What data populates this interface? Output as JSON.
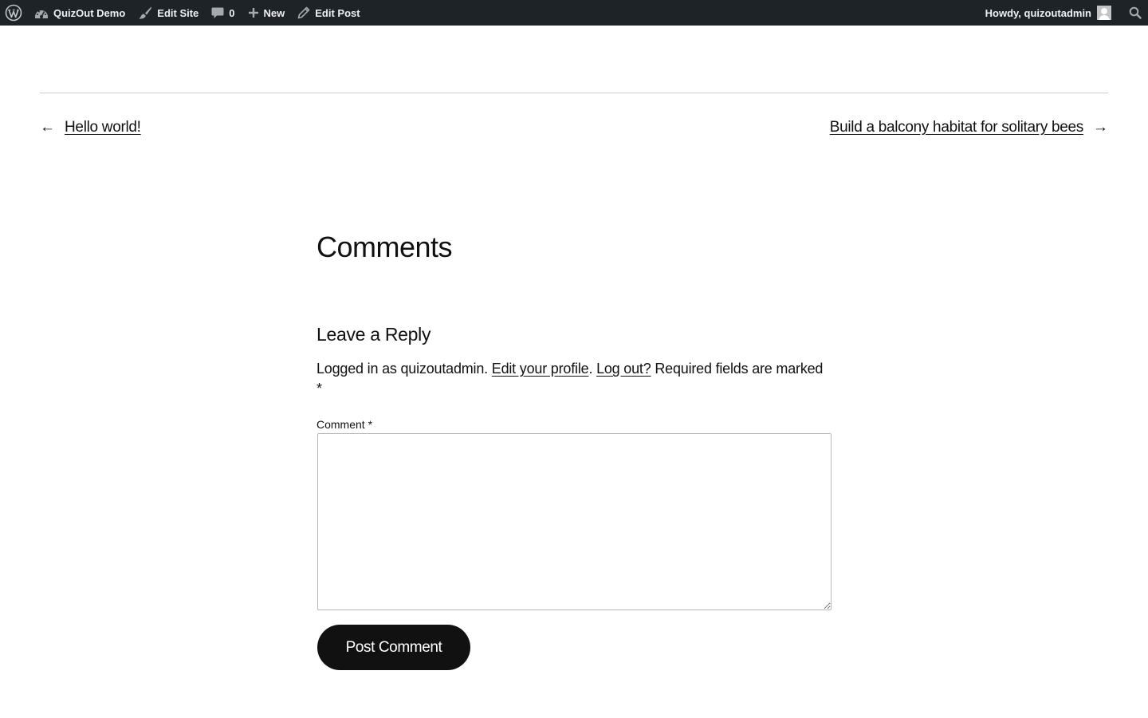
{
  "admin_bar": {
    "wp_logo_icon": "wordpress-logo-icon",
    "site_name": "QuizOut Demo",
    "site_icon": "dashboard-icon",
    "edit_site": "Edit Site",
    "edit_site_icon": "brush-icon",
    "comments_count": "0",
    "comments_icon": "comment-bubble-icon",
    "new_label": "New",
    "new_icon": "plus-icon",
    "edit_post": "Edit Post",
    "edit_post_icon": "pencil-icon",
    "howdy": "Howdy, quizoutadmin",
    "avatar_icon": "avatar-icon",
    "search_icon": "search-icon",
    "bar_color": "#1d2327"
  },
  "post_nav": {
    "prev_arrow": "←",
    "prev_title": "Hello world!",
    "next_title": "Build a balcony habitat for solitary bees",
    "next_arrow": "→"
  },
  "comments": {
    "title": "Comments",
    "reply_title": "Leave a Reply",
    "logged_in_prefix": "Logged in as quizoutadmin. ",
    "edit_profile": "Edit your profile",
    "dot": ".",
    "logout": "Log out?",
    "required_note": " Required fields are marked *",
    "comment_label": "Comment *",
    "comment_value": "",
    "submit_label": "Post Comment",
    "button_color": "#111111"
  }
}
